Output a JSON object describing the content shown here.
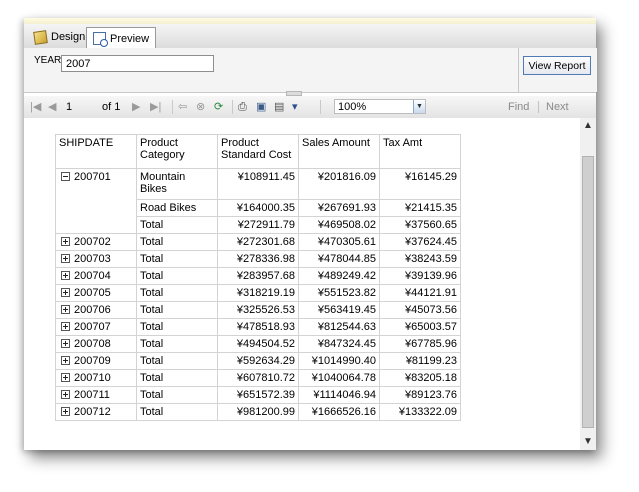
{
  "tabs": {
    "design": "Design",
    "preview": "Preview"
  },
  "params": {
    "year_label": "YEAR",
    "year_value": "2007",
    "view_report": "View Report"
  },
  "toolbar": {
    "page": "1",
    "of_label": "of 1",
    "zoom": "100%",
    "find": "Find",
    "next": "Next"
  },
  "report": {
    "headers": [
      "SHIPDATE",
      "Product Category",
      "Product Standard Cost",
      "Sales Amount",
      "Tax Amt"
    ],
    "expanded_group": {
      "shipdate": "200701",
      "rows": [
        {
          "category": "Mountain Bikes",
          "cost": "¥108911.45",
          "sales": "¥201816.09",
          "tax": "¥16145.29"
        },
        {
          "category": "Road Bikes",
          "cost": "¥164000.35",
          "sales": "¥267691.93",
          "tax": "¥21415.35"
        },
        {
          "category": "Total",
          "cost": "¥272911.79",
          "sales": "¥469508.02",
          "tax": "¥37560.65"
        }
      ]
    },
    "collapsed_rows": [
      {
        "shipdate": "200702",
        "category": "Total",
        "cost": "¥272301.68",
        "sales": "¥470305.61",
        "tax": "¥37624.45"
      },
      {
        "shipdate": "200703",
        "category": "Total",
        "cost": "¥278336.98",
        "sales": "¥478044.85",
        "tax": "¥38243.59"
      },
      {
        "shipdate": "200704",
        "category": "Total",
        "cost": "¥283957.68",
        "sales": "¥489249.42",
        "tax": "¥39139.96"
      },
      {
        "shipdate": "200705",
        "category": "Total",
        "cost": "¥318219.19",
        "sales": "¥551523.82",
        "tax": "¥44121.91"
      },
      {
        "shipdate": "200706",
        "category": "Total",
        "cost": "¥325526.53",
        "sales": "¥563419.45",
        "tax": "¥45073.56"
      },
      {
        "shipdate": "200707",
        "category": "Total",
        "cost": "¥478518.93",
        "sales": "¥812544.63",
        "tax": "¥65003.57"
      },
      {
        "shipdate": "200708",
        "category": "Total",
        "cost": "¥494504.52",
        "sales": "¥847324.45",
        "tax": "¥67785.96"
      },
      {
        "shipdate": "200709",
        "category": "Total",
        "cost": "¥592634.29",
        "sales": "¥1014990.40",
        "tax": "¥81199.23"
      },
      {
        "shipdate": "200710",
        "category": "Total",
        "cost": "¥607810.72",
        "sales": "¥1040064.78",
        "tax": "¥83205.18"
      },
      {
        "shipdate": "200711",
        "category": "Total",
        "cost": "¥651572.39",
        "sales": "¥1114046.94",
        "tax": "¥89123.76"
      },
      {
        "shipdate": "200712",
        "category": "Total",
        "cost": "¥981200.99",
        "sales": "¥1666526.16",
        "tax": "¥133322.09"
      }
    ]
  }
}
